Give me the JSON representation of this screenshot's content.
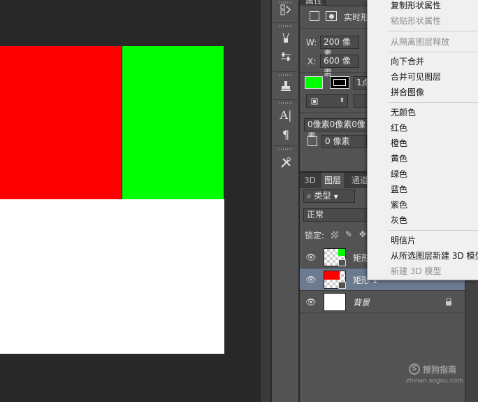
{
  "properties": {
    "tab_label": "属性",
    "realtime_label": "实时形",
    "w_label": "W:",
    "w_value": "200 像素",
    "x_label": "X:",
    "x_value": "600 像素",
    "stroke_width": "1点",
    "padding_value": "0像素0像素0像素",
    "corner_value": "0 像素",
    "fill_color": "#00ff00"
  },
  "layers_panel": {
    "tabs": [
      {
        "label": "3D"
      },
      {
        "label": "图层"
      },
      {
        "label": "通道"
      }
    ],
    "filter_label": "类型",
    "blend_mode": "正常",
    "lock_label": "锁定:",
    "layers": [
      {
        "name": "矩形",
        "thumb_color": "#00ff00",
        "selected": false
      },
      {
        "name": "矩形 1",
        "thumb_color": "#ff0000",
        "selected": true
      },
      {
        "name": "背景",
        "thumb_color": "#ffffff",
        "selected": false
      }
    ]
  },
  "context_menu": {
    "items": [
      {
        "label": "复制形状属性",
        "enabled": true
      },
      {
        "label": "粘贴形状属性",
        "enabled": false
      },
      {
        "label": "从隔离图层释放",
        "enabled": false
      },
      {
        "label": "向下合并",
        "enabled": true
      },
      {
        "label": "合并可见图层",
        "enabled": true
      },
      {
        "label": "拼合图像",
        "enabled": true
      },
      {
        "label": "无颜色",
        "enabled": true
      },
      {
        "label": "红色",
        "enabled": true
      },
      {
        "label": "橙色",
        "enabled": true
      },
      {
        "label": "黄色",
        "enabled": true
      },
      {
        "label": "绿色",
        "enabled": true
      },
      {
        "label": "蓝色",
        "enabled": true
      },
      {
        "label": "紫色",
        "enabled": true
      },
      {
        "label": "灰色",
        "enabled": true
      },
      {
        "label": "明信片",
        "enabled": true
      },
      {
        "label": "从所选图层新建 3D 模型",
        "enabled": true
      },
      {
        "label": "新建 3D 模型",
        "enabled": false
      }
    ]
  },
  "canvas": {
    "colors": {
      "red": "#ff0000",
      "green": "#00ff00",
      "white": "#ffffff"
    }
  },
  "watermark": {
    "logo_char": "S",
    "text": "搜狗指南",
    "url": "zhinan.sogou.com"
  }
}
